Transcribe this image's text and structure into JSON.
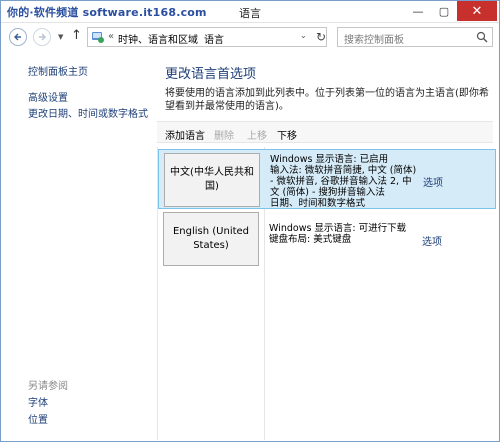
{
  "watermark": "你的·软件频道 software.it168.com",
  "window": {
    "title": "语言",
    "minimize": "—",
    "maximize": "▢",
    "close": "✕"
  },
  "address": {
    "separator": "«",
    "crumb1": "时钟、语言和区域",
    "crumb2": "语言",
    "chevron": "›",
    "dropdown": "⌄",
    "refresh": "↻"
  },
  "search": {
    "placeholder": "搜索控制面板"
  },
  "sidebar": {
    "home": "控制面板主页",
    "advanced": "高级设置",
    "datetime": "更改日期、时间或数字格式",
    "see_also": "另请参阅",
    "font": "字体",
    "location": "位置"
  },
  "main": {
    "title": "更改语言首选项",
    "description": "将要使用的语言添加到此列表中。位于列表第一位的语言为主语言(即你希望看到并最常使用的语言)。"
  },
  "toolbar": {
    "add": "添加语言",
    "remove": "删除",
    "move_up": "上移",
    "move_down": "下移"
  },
  "languages": [
    {
      "name": "中文(中华人民共和国)",
      "status": "Windows 显示语言: 已启用",
      "input": "输入法: 微软拼音简捷, 中文 (简体) - 微软拼音, 谷歌拼音输入法 2, 中文 (简体) - 搜狗拼音输入法",
      "format": "日期、时间和数字格式",
      "options": "选项"
    },
    {
      "name": "English (United States)",
      "status": "Windows 显示语言: 可进行下载",
      "input": "键盘布局: 美式键盘",
      "format": "",
      "options": "选项"
    }
  ],
  "colors": {
    "accent": "#1e3f78",
    "selection": "#d6ebf8",
    "selection_border": "#7dc2e8",
    "close": "#c7302c"
  }
}
